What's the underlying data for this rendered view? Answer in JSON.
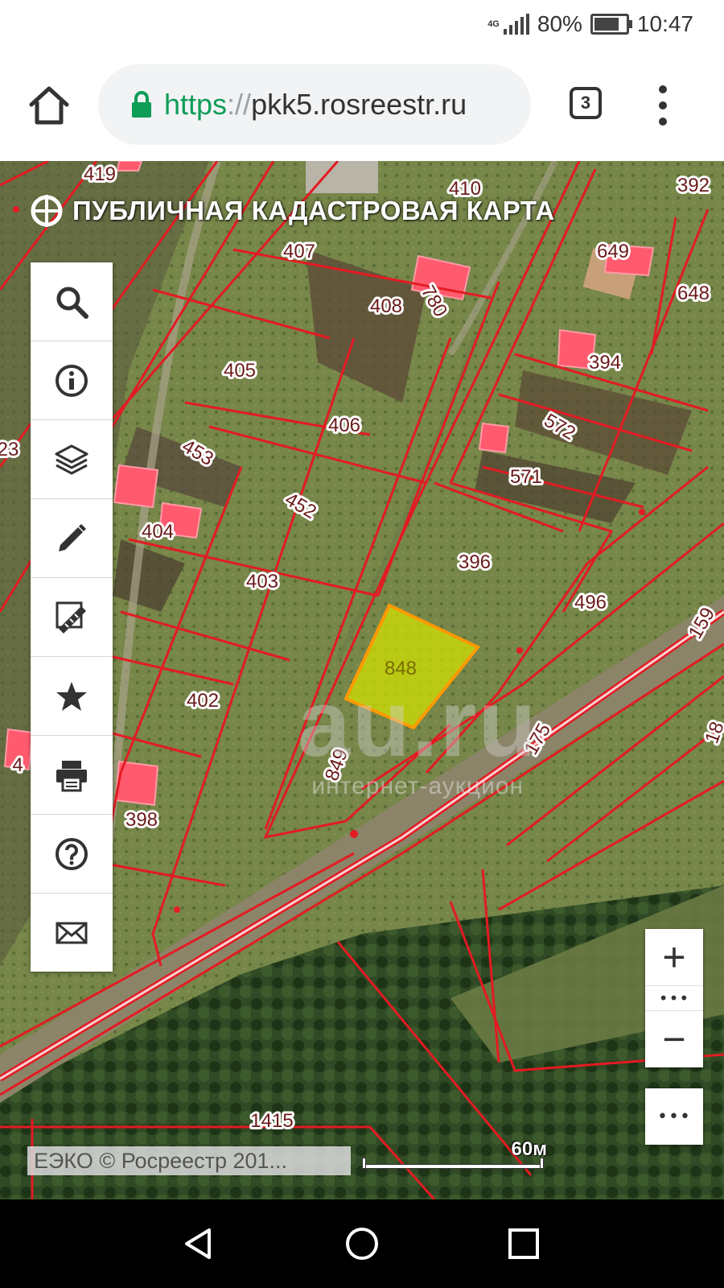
{
  "status_bar": {
    "network": "4G",
    "battery_text": "80%",
    "battery_level": 0.8,
    "time": "10:47"
  },
  "browser": {
    "home_icon": "home-icon",
    "url_scheme": "https",
    "url_separator": "://",
    "url_host": "pkk5.rosreestr.ru",
    "tab_count": "3",
    "menu_icon": "more-vert-icon",
    "lock_icon": "lock-icon",
    "lock_color": "#0f9d58"
  },
  "map": {
    "title": "ПУБЛИЧНАЯ КАДАСТРОВАЯ КАРТА",
    "logo_icon": "globe-logo-icon",
    "boundary_color": "#e31b23",
    "selected_parcel_color": "#d4e400",
    "building_color": "#ff5a6e",
    "toolbar": [
      {
        "name": "search",
        "icon": "search-icon"
      },
      {
        "name": "info",
        "icon": "info-icon"
      },
      {
        "name": "layers",
        "icon": "layers-icon"
      },
      {
        "name": "draw",
        "icon": "pencil-icon"
      },
      {
        "name": "measure",
        "icon": "ruler-icon"
      },
      {
        "name": "favorites",
        "icon": "star-icon"
      },
      {
        "name": "print",
        "icon": "print-icon"
      },
      {
        "name": "help",
        "icon": "help-icon"
      },
      {
        "name": "feedback",
        "icon": "mail-icon"
      }
    ],
    "parcels": [
      "419",
      "410",
      "392",
      "407",
      "649",
      "648",
      "780",
      "408",
      "394",
      "405",
      "406",
      "572",
      "453",
      "23",
      "571",
      "452",
      "404",
      "396",
      "403",
      "496",
      "848",
      "175",
      "402",
      "849",
      "398",
      "1415",
      "159",
      "18",
      "4"
    ],
    "selected_parcel": "848",
    "zoom_in": "+",
    "zoom_out": "−",
    "zoom_dots": "•••",
    "more": "•••",
    "copyright": "ЕЭКО © Росреестр 201...",
    "scale_label": "60м",
    "watermark": "au.ru",
    "watermark_sub": "интернет-аукцион"
  },
  "nav_bar": {
    "back_icon": "back-triangle-icon",
    "home_icon": "home-circle-icon",
    "recents_icon": "recents-square-icon"
  }
}
